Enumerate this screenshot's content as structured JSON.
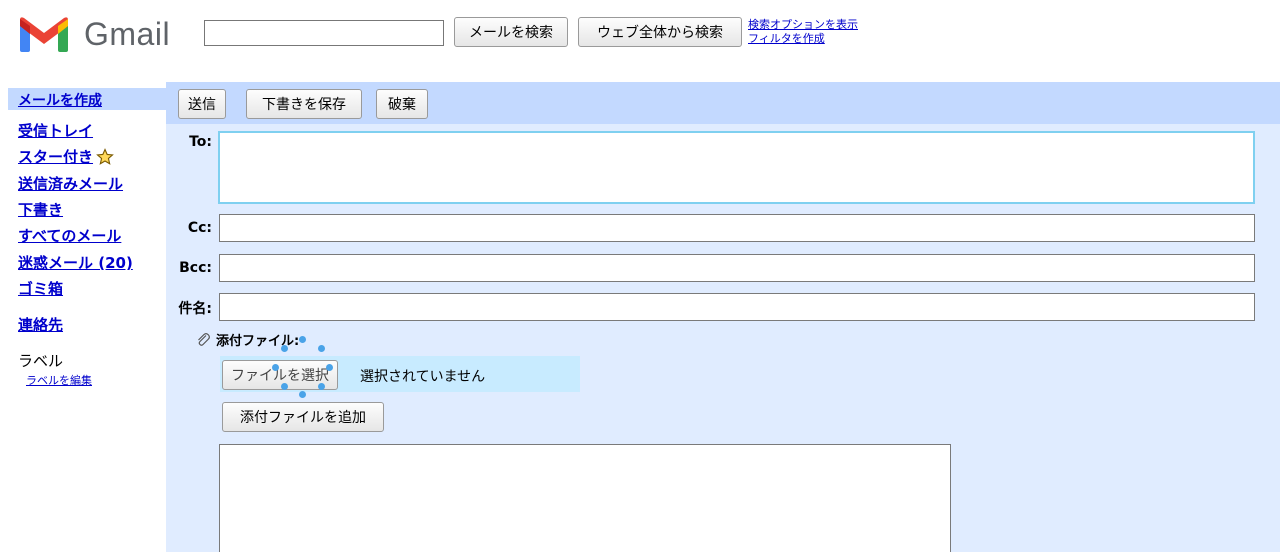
{
  "app": {
    "name": "Gmail"
  },
  "topbar": {
    "search_value": "",
    "search_mail_button": "メールを検索",
    "search_web_button": "ウェブ全体から検索",
    "search_options_link": "検索オプションを表示",
    "create_filter_link": "フィルタを作成"
  },
  "sidebar": {
    "compose": "メールを作成",
    "items": [
      {
        "label": "受信トレイ"
      },
      {
        "label": "スター付き",
        "icon": "star-icon"
      },
      {
        "label": "送信済みメール"
      },
      {
        "label": "下書き"
      },
      {
        "label": "すべてのメール"
      },
      {
        "label": "迷惑メール (20)"
      },
      {
        "label": "ゴミ箱"
      }
    ],
    "contacts": "連絡先",
    "labels_title": "ラベル",
    "edit_labels": "ラベルを編集"
  },
  "toolbar": {
    "send": "送信",
    "save_draft": "下書きを保存",
    "discard": "破棄"
  },
  "compose": {
    "to_label": "To:",
    "to_value": "",
    "cc_label": "Cc:",
    "cc_value": "",
    "bcc_label": "Bcc:",
    "bcc_value": "",
    "subject_label": "件名:",
    "subject_value": "",
    "attachment_label": "添付ファイル:",
    "choose_file_button": "ファイルを選択",
    "no_file_text": "選択されていません",
    "add_attachment_button": "添付ファイルを追加",
    "body_value": ""
  },
  "colors": {
    "main_bg": "#e0ecff",
    "toolbar_bg": "#c3d9ff",
    "link": "#0000cc",
    "focus": "#7fd0f0"
  }
}
